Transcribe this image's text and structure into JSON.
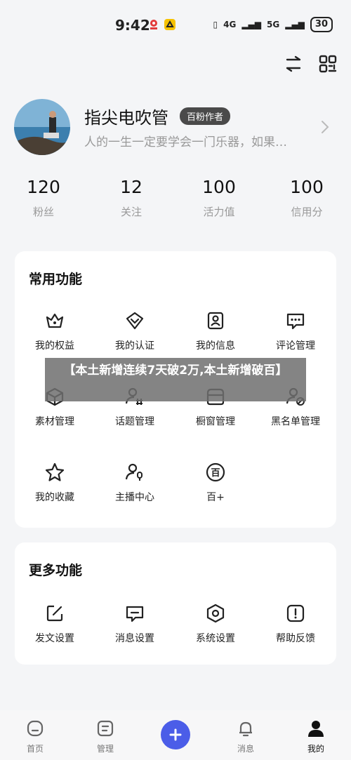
{
  "status_bar": {
    "time": "9:42",
    "network1": "4G",
    "network2": "5G",
    "battery": "30"
  },
  "profile": {
    "name": "指尖电吹管",
    "badge": "百粉作者",
    "bio": "人的一生一定要学会一门乐器，如果…"
  },
  "stats": [
    {
      "value": "120",
      "label": "粉丝"
    },
    {
      "value": "12",
      "label": "关注"
    },
    {
      "value": "100",
      "label": "活力值"
    },
    {
      "value": "100",
      "label": "信用分"
    }
  ],
  "common_functions": {
    "title": "常用功能",
    "items": [
      {
        "label": "我的权益",
        "icon": "crown-icon"
      },
      {
        "label": "我的认证",
        "icon": "verified-heart-icon"
      },
      {
        "label": "我的信息",
        "icon": "profile-card-icon"
      },
      {
        "label": "评论管理",
        "icon": "comment-icon"
      },
      {
        "label": "素材管理",
        "icon": "box-icon"
      },
      {
        "label": "话题管理",
        "icon": "topic-user-icon"
      },
      {
        "label": "橱窗管理",
        "icon": "storefront-icon"
      },
      {
        "label": "黑名单管理",
        "icon": "blocked-user-icon"
      },
      {
        "label": "我的收藏",
        "icon": "star-icon"
      },
      {
        "label": "主播中心",
        "icon": "host-mic-icon"
      },
      {
        "label": "百+",
        "icon": "bai-circle-icon"
      }
    ]
  },
  "more_functions": {
    "title": "更多功能",
    "items": [
      {
        "label": "发文设置",
        "icon": "edit-icon"
      },
      {
        "label": "消息设置",
        "icon": "message-icon"
      },
      {
        "label": "系统设置",
        "icon": "settings-hex-icon"
      },
      {
        "label": "帮助反馈",
        "icon": "help-icon"
      }
    ]
  },
  "overlay": {
    "text": "【本土新增连续7天破2万,本土新增破百】"
  },
  "tab_bar": {
    "tabs": [
      {
        "label": "首页",
        "icon": "home-icon"
      },
      {
        "label": "管理",
        "icon": "manage-icon"
      },
      {
        "label": "",
        "icon": "plus-icon"
      },
      {
        "label": "消息",
        "icon": "bell-icon"
      },
      {
        "label": "我的",
        "icon": "user-icon"
      }
    ],
    "active": "我的"
  },
  "colors": {
    "accent": "#4b5de8",
    "background": "#f4f5f7",
    "badge": "#4a4a4a"
  }
}
